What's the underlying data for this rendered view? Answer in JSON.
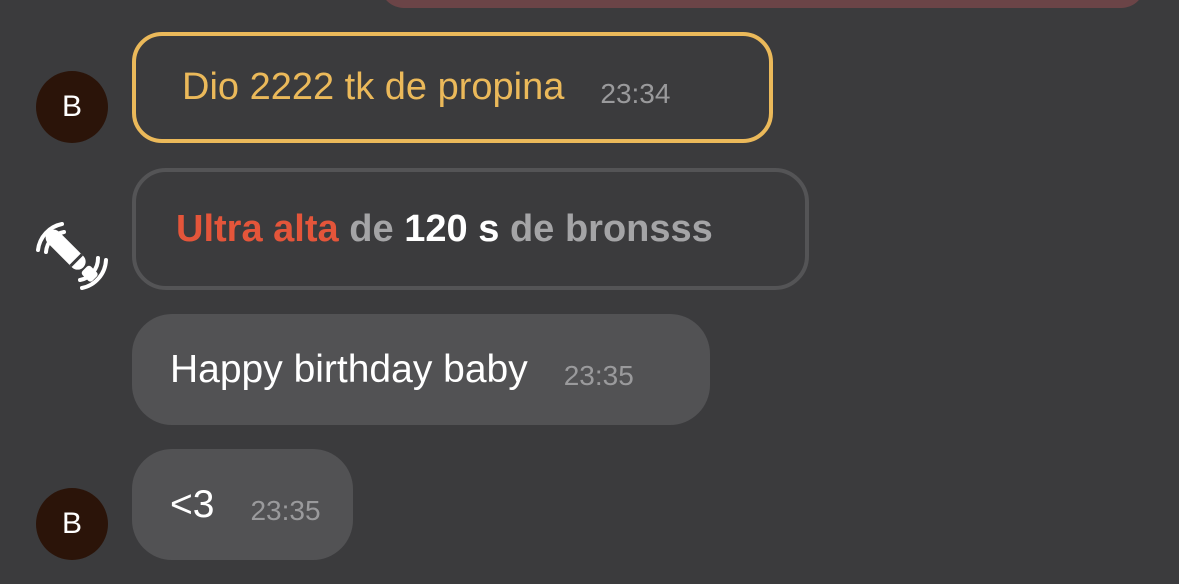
{
  "messages": [
    {
      "avatar_initial": "B",
      "text": "Dio 2222 tk de propina",
      "time": "23:34"
    },
    {
      "vibe_level": "Ultra alta",
      "word_de_1": "de",
      "duration": "120 s",
      "word_de_2": "de",
      "user": "bronsss"
    },
    {
      "text": "Happy birthday baby",
      "time": "23:35"
    },
    {
      "avatar_initial": "B",
      "text": "<3",
      "time": "23:35"
    }
  ],
  "icons": {
    "vibration": "vibrator-waves-icon"
  },
  "colors": {
    "background": "#3b3b3d",
    "tip_accent": "#ebb95a",
    "vibe_level": "#e4553a",
    "bubble": "#525254",
    "avatar": "#2b1409",
    "top_bubble": "#6b4447"
  }
}
